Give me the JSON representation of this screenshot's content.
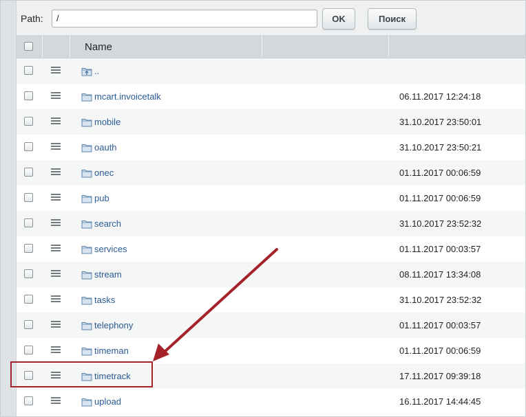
{
  "toolbar": {
    "path_label": "Path:",
    "path_value": "/",
    "ok_label": "OK",
    "search_label": "Поиск"
  },
  "header": {
    "name_label": "Name"
  },
  "rows": [
    {
      "name": "..",
      "date": "",
      "icon": "folder-up-icon"
    },
    {
      "name": "mcart.invoicetalk",
      "date": "06.11.2017 12:24:18",
      "icon": "folder-icon"
    },
    {
      "name": "mobile",
      "date": "31.10.2017 23:50:01",
      "icon": "folder-icon"
    },
    {
      "name": "oauth",
      "date": "31.10.2017 23:50:21",
      "icon": "folder-icon"
    },
    {
      "name": "onec",
      "date": "01.11.2017 00:06:59",
      "icon": "folder-icon"
    },
    {
      "name": "pub",
      "date": "01.11.2017 00:06:59",
      "icon": "folder-icon"
    },
    {
      "name": "search",
      "date": "31.10.2017 23:52:32",
      "icon": "folder-icon"
    },
    {
      "name": "services",
      "date": "01.11.2017 00:03:57",
      "icon": "folder-icon"
    },
    {
      "name": "stream",
      "date": "08.11.2017 13:34:08",
      "icon": "folder-icon"
    },
    {
      "name": "tasks",
      "date": "31.10.2017 23:52:32",
      "icon": "folder-icon"
    },
    {
      "name": "telephony",
      "date": "01.11.2017 00:03:57",
      "icon": "folder-icon"
    },
    {
      "name": "timeman",
      "date": "01.11.2017 00:06:59",
      "icon": "folder-icon"
    },
    {
      "name": "timetrack",
      "date": "17.11.2017 09:39:18",
      "icon": "folder-icon"
    },
    {
      "name": "upload",
      "date": "16.11.2017 14:44:45",
      "icon": "folder-icon"
    }
  ],
  "annotation": {
    "highlighted_item": "timetrack",
    "highlight_color": "#a6222b"
  },
  "colors": {
    "link": "#2a5a94",
    "header_bg": "#d3d9db",
    "toolbar_bg": "#eef0f1"
  }
}
